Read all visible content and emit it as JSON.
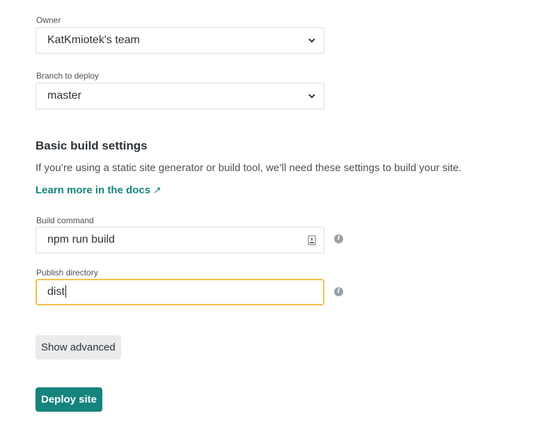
{
  "owner": {
    "label": "Owner",
    "value": "KatKmiotek's team"
  },
  "branch": {
    "label": "Branch to deploy",
    "value": "master"
  },
  "build_settings": {
    "heading": "Basic build settings",
    "description": "If you’re using a static site generator or build tool, we’ll need these settings to build your site.",
    "docs_link": "Learn more in the docs",
    "docs_link_icon": "external-arrow-icon"
  },
  "build_command": {
    "label": "Build command",
    "value": "npm run build",
    "icon": "lock-icon"
  },
  "publish_directory": {
    "label": "Publish directory",
    "value": "dist"
  },
  "buttons": {
    "show_advanced": "Show advanced",
    "deploy": "Deploy site"
  },
  "colors": {
    "accent": "#15847d",
    "focus": "#f2c14e"
  }
}
